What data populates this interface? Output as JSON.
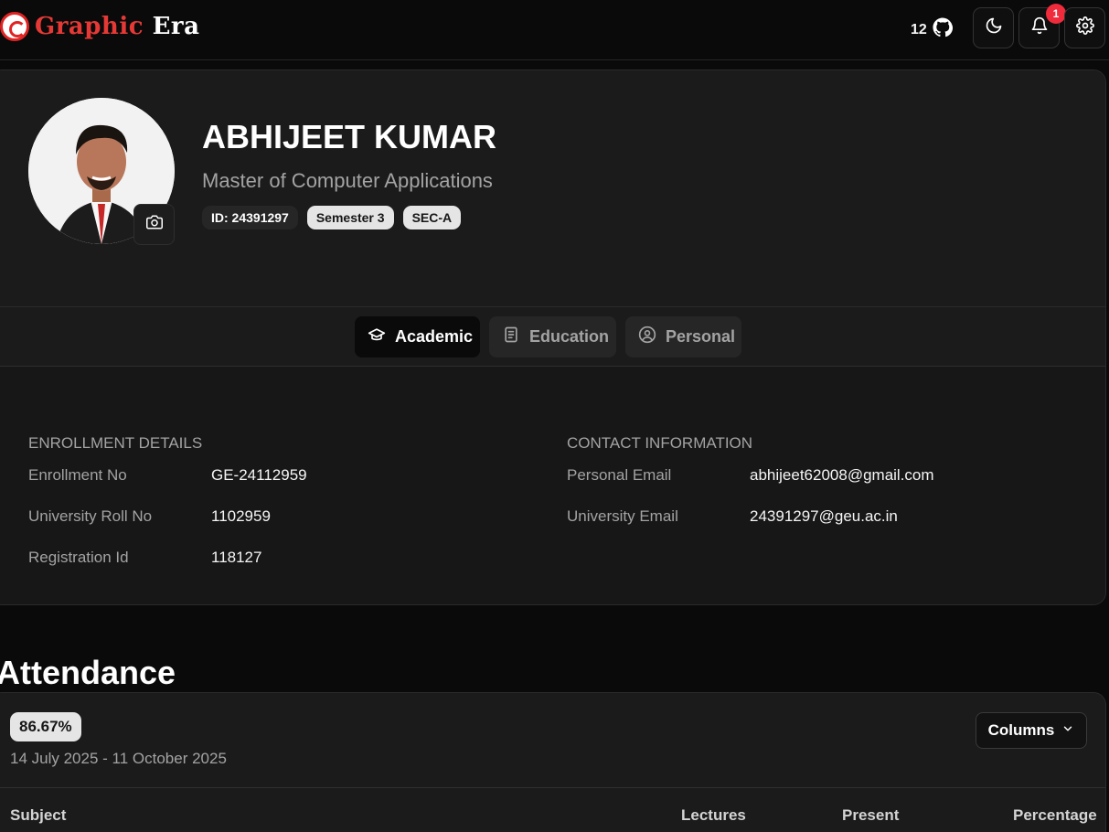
{
  "header": {
    "logo_text_red": "Graphic",
    "logo_text_white": "Era",
    "github_stars": "12"
  },
  "profile": {
    "name": "ABHIJEET KUMAR",
    "program": "Master of Computer Applications",
    "id_badge": "ID: 24391297",
    "semester_badge": "Semester 3",
    "section_badge": "SEC-A"
  },
  "tabs": [
    {
      "label": "Academic",
      "icon": "graduation-cap-icon",
      "active": true
    },
    {
      "label": "Education",
      "icon": "book-icon",
      "active": false
    },
    {
      "label": "Personal",
      "icon": "user-circle-icon",
      "active": false
    }
  ],
  "enrollment": {
    "heading": "ENROLLMENT DETAILS",
    "fields": [
      {
        "label": "Enrollment No",
        "value": "GE-24112959"
      },
      {
        "label": "University Roll No",
        "value": "1102959"
      },
      {
        "label": "Registration Id",
        "value": "118127"
      }
    ]
  },
  "contact": {
    "heading": "CONTACT INFORMATION",
    "fields": [
      {
        "label": "Personal Email",
        "value": "abhijeet62008@gmail.com"
      },
      {
        "label": "University Email",
        "value": "24391297@geu.ac.in"
      }
    ]
  },
  "attendance": {
    "title": "Attendance",
    "percentage": "86.67%",
    "date_range": "14 July 2025 - 11 October 2025",
    "columns_button": "Columns",
    "table_headers": [
      "Subject",
      "Lectures",
      "Present",
      "Percentage"
    ]
  },
  "colors": {
    "background": "#0a0a0a",
    "card": "#171717",
    "accent_red": "#e53935",
    "notification_badge": "#ef2b3c"
  },
  "notifications": {
    "count": "1"
  }
}
